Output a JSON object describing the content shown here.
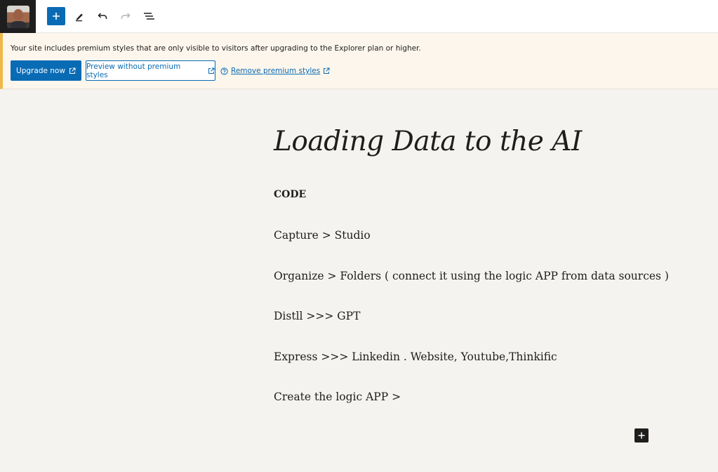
{
  "toolbar": {
    "add_block": "Add block",
    "tools": "Tools",
    "undo": "Undo",
    "redo": "Redo",
    "document_overview": "Document Overview"
  },
  "notice": {
    "message": "Your site includes premium styles that are only visible to visitors after upgrading to the Explorer plan or higher.",
    "upgrade_label": "Upgrade now",
    "preview_label": "Preview without premium styles",
    "remove_label": "Remove premium styles"
  },
  "post": {
    "title": "Loading Data to the AI",
    "paragraphs": [
      "CODE",
      "Capture > Studio",
      "Organize > Folders ( connect it using the logic APP from data sources )",
      "Distll >>> GPT",
      "Express >>> Linkedin . Website, Youtube,Thinkific",
      "Create the logic APP >"
    ]
  },
  "colors": {
    "accent": "#0a6bb5",
    "notice_border": "#f0b849",
    "notice_bg": "#fdf6ec",
    "canvas_bg": "#f5f3ef",
    "text": "#1e1e1e"
  },
  "icons": {
    "site": "site-avatar-icon",
    "add": "plus-icon",
    "edit": "pencil-icon",
    "undo": "undo-icon",
    "redo": "redo-icon",
    "overview": "list-view-icon",
    "external": "external-link-icon",
    "help": "help-circle-icon"
  }
}
